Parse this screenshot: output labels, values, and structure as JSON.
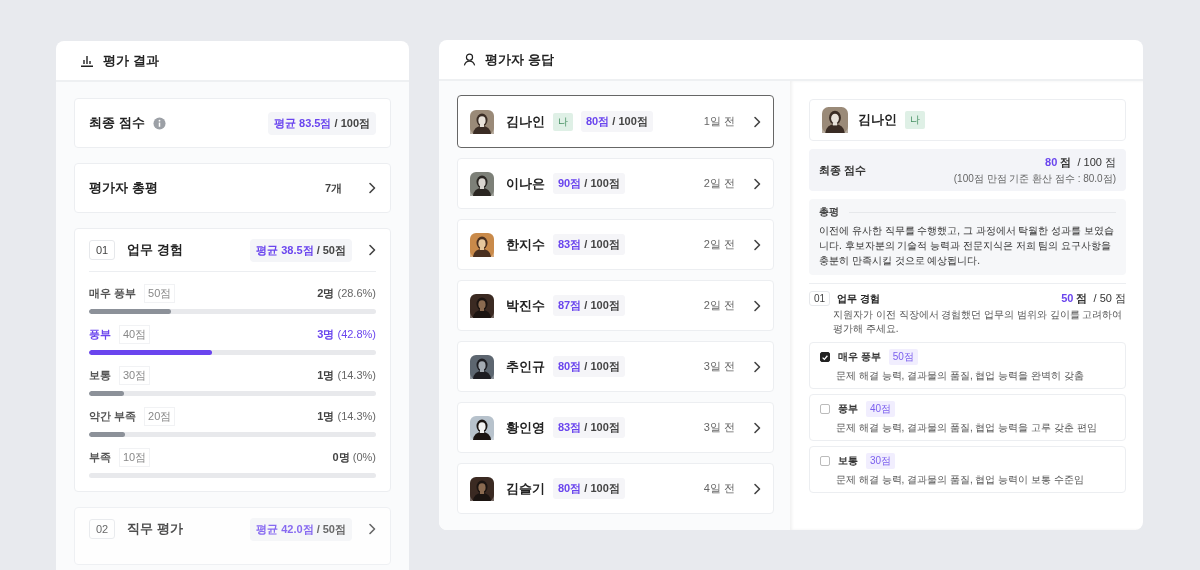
{
  "results_panel": {
    "title": "평가 결과",
    "final_score": {
      "label": "최종 점수",
      "average": "평균 83.5점",
      "total": "/ 100점"
    },
    "summary": {
      "label": "평가자 총평",
      "count": "7개"
    },
    "sections": [
      {
        "number": "01",
        "title": "업무 경험",
        "average": "평균 38.5점",
        "total": "/ 50점",
        "expanded": true,
        "options": [
          {
            "label": "매우 풍부",
            "points": "50점",
            "count": "2명",
            "percent": "(28.6%)",
            "level": 0.286,
            "selected": false
          },
          {
            "label": "풍부",
            "points": "40점",
            "count": "3명",
            "percent": "(42.8%)",
            "level": 0.428,
            "selected": true
          },
          {
            "label": "보통",
            "points": "30점",
            "count": "1명",
            "percent": "(14.3%)",
            "level": 0.123,
            "selected": false
          },
          {
            "label": "약간 부족",
            "points": "20점",
            "count": "1명",
            "percent": "(14.3%)",
            "level": 0.127,
            "selected": false
          },
          {
            "label": "부족",
            "points": "10점",
            "count": "0명",
            "percent": "(0%)",
            "level": 0,
            "selected": false
          }
        ]
      },
      {
        "number": "02",
        "title": "직무 평가",
        "average": "평균 42.0점",
        "total": "/ 50점",
        "expanded": false
      }
    ]
  },
  "responses_panel": {
    "title": "평가자 응답",
    "responses": [
      {
        "name": "김나인",
        "me_badge": "나",
        "score": "80점",
        "total": "/ 100점",
        "time": "1일 전",
        "selected": true
      },
      {
        "name": "이나은",
        "score": "90점",
        "total": "/ 100점",
        "time": "2일 전",
        "selected": false
      },
      {
        "name": "한지수",
        "score": "83점",
        "total": "/ 100점",
        "time": "2일 전",
        "selected": false
      },
      {
        "name": "박진수",
        "score": "87점",
        "total": "/ 100점",
        "time": "2일 전",
        "selected": false
      },
      {
        "name": "추인규",
        "score": "80점",
        "total": "/ 100점",
        "time": "3일 전",
        "selected": false
      },
      {
        "name": "황인영",
        "score": "83점",
        "total": "/ 100점",
        "time": "3일 전",
        "selected": false
      },
      {
        "name": "김슬기",
        "score": "80점",
        "total": "/ 100점",
        "time": "4일 전",
        "selected": false
      }
    ],
    "detail": {
      "name": "김나인",
      "me_badge": "나",
      "final_score": {
        "label": "최종 점수",
        "score": "80",
        "unit": "점",
        "max": "/ 100 점",
        "note": "(100점 만점 기준 환산 점수 : 80.0점)"
      },
      "comment": {
        "label": "총평",
        "text": "이전에 유사한 직무를 수행했고, 그 과정에서 탁월한 성과를 보였습니다. 후보자분의 기술적 능력과 전문지식은 저희 팀의 요구사항을 충분히 만족시킬 것으로 예상됩니다."
      },
      "question": {
        "number": "01",
        "title": "업무 경험",
        "score": "50",
        "unit": "점",
        "max": "/ 50 점",
        "description": "지원자가 이전 직장에서 경험했던 업무의 범위와 깊이를 고려하여 평가해 주세요.",
        "options": [
          {
            "label": "매우 풍부",
            "points": "50점",
            "description": "문제 해결 능력, 결과물의 품질, 협업 능력을 완벽히 갖춤",
            "checked": true
          },
          {
            "label": "풍부",
            "points": "40점",
            "description": "문제 해결 능력, 결과물의 품질, 협업 능력을 고루 갖춘 편임",
            "checked": false
          },
          {
            "label": "보통",
            "points": "30점",
            "description": "문제 해결 능력, 결과물의 품질, 협업 능력이 보통 수준임",
            "checked": false
          }
        ]
      }
    }
  }
}
